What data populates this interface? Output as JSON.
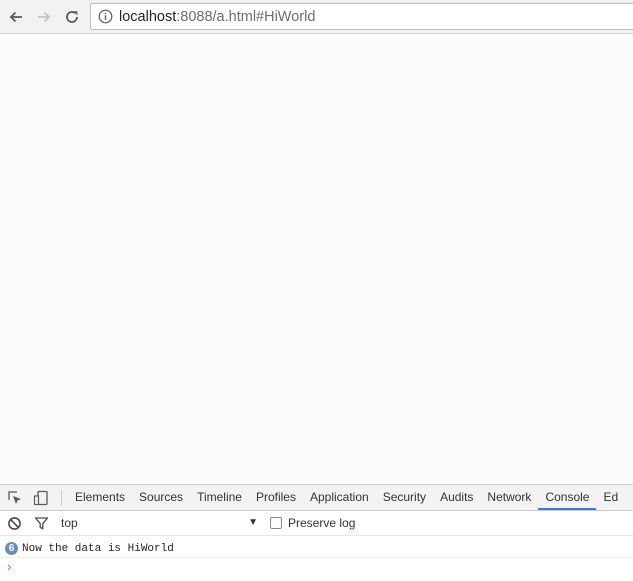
{
  "browser": {
    "url": {
      "host": "localhost",
      "rest": ":8088/a.html#HiWorld"
    },
    "icons": {
      "back": "arrow-left-icon",
      "forward": "arrow-right-icon",
      "reload": "reload-icon",
      "info": "info-icon"
    }
  },
  "devtools": {
    "tabs": [
      {
        "label": "Elements",
        "active": false
      },
      {
        "label": "Sources",
        "active": false
      },
      {
        "label": "Timeline",
        "active": false
      },
      {
        "label": "Profiles",
        "active": false
      },
      {
        "label": "Application",
        "active": false
      },
      {
        "label": "Security",
        "active": false
      },
      {
        "label": "Audits",
        "active": false
      },
      {
        "label": "Network",
        "active": false
      },
      {
        "label": "Console",
        "active": true
      },
      {
        "label": "Ed",
        "active": false
      }
    ],
    "filter": {
      "context": "top",
      "preserve_log_label": "Preserve log",
      "preserve_log_checked": false
    },
    "messages": [
      {
        "count": "6",
        "text": "Now the data is HiWorld"
      }
    ],
    "colors": {
      "active_tab_underline": "#3879d9",
      "badge": "#6b8fb3",
      "prompt": "#367cf1"
    }
  }
}
